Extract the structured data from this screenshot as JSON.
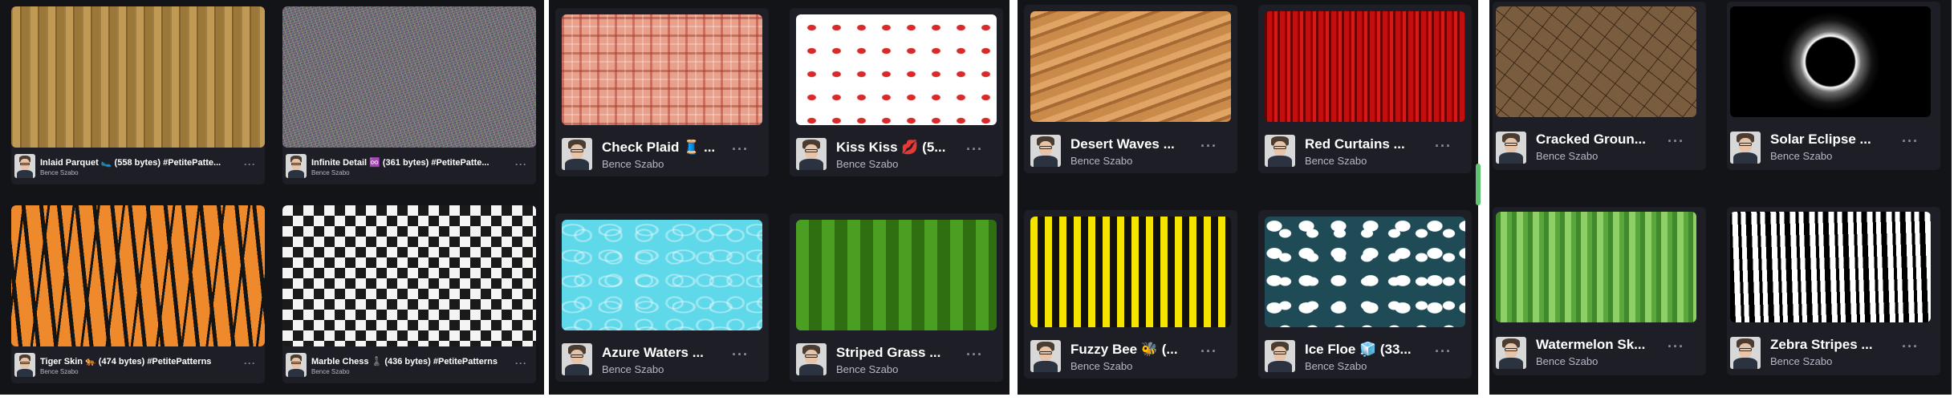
{
  "panels": [
    {
      "cards": [
        {
          "title": "Inlaid Parquet 🥿 (558 bytes) #PetitePatte...",
          "author": "Bence Szabo",
          "more_label": "···",
          "pattern": "parquet-pattern"
        },
        {
          "title": "Infinite Detail ♾️ (361 bytes) #PetitePatte...",
          "author": "Bence Szabo",
          "more_label": "···",
          "pattern": "noise-pattern"
        },
        {
          "title": "Tiger Skin 🐅 (474 bytes) #PetitePatterns",
          "author": "Bence Szabo",
          "more_label": "···",
          "pattern": "tiger-pattern"
        },
        {
          "title": "Marble Chess ♟️ (436 bytes) #PetitePatterns",
          "author": "Bence Szabo",
          "more_label": "···",
          "pattern": "checker-pattern"
        }
      ]
    },
    {
      "cards": [
        {
          "title": "Check Plaid 🧵 ...",
          "author": "Bence Szabo",
          "more_label": "···",
          "pattern": "plaid-pattern"
        },
        {
          "title": "Kiss Kiss 💋 (5...",
          "author": "Bence Szabo",
          "more_label": "···",
          "pattern": "lips-pattern"
        },
        {
          "title": "Azure Waters ...",
          "author": "Bence Szabo",
          "more_label": "···",
          "pattern": "water-pattern"
        },
        {
          "title": "Striped Grass ...",
          "author": "Bence Szabo",
          "more_label": "···",
          "pattern": "grass-pattern"
        }
      ]
    },
    {
      "cards": [
        {
          "title": "Desert Waves ...",
          "author": "Bence Szabo",
          "more_label": "···",
          "pattern": "dunes-pattern"
        },
        {
          "title": "Red Curtains ...",
          "author": "Bence Szabo",
          "more_label": "···",
          "pattern": "curtain-pattern"
        },
        {
          "title": "Fuzzy Bee 🐝 (...",
          "author": "Bence Szabo",
          "more_label": "···",
          "pattern": "bee-pattern"
        },
        {
          "title": "Ice Floe 🧊 (33...",
          "author": "Bence Szabo",
          "more_label": "···",
          "pattern": "ice-floe-pattern"
        }
      ]
    },
    {
      "cards": [
        {
          "title": "Cracked Groun...",
          "author": "Bence Szabo",
          "more_label": "···",
          "pattern": "cracked-ground-pattern"
        },
        {
          "title": "Solar Eclipse ...",
          "author": "Bence Szabo",
          "more_label": "···",
          "pattern": "eclipse-pattern"
        },
        {
          "title": "Watermelon Sk...",
          "author": "Bence Szabo",
          "more_label": "···",
          "pattern": "watermelon-pattern"
        },
        {
          "title": "Zebra Stripes ...",
          "author": "Bence Szabo",
          "more_label": "···",
          "pattern": "zebra-pattern"
        }
      ]
    }
  ],
  "colors": {
    "panel_bg": "#131417",
    "card_bg": "#1e1f26",
    "title": "#ffffff",
    "author": "#b5b7c4",
    "accent": "#5ec46f"
  }
}
